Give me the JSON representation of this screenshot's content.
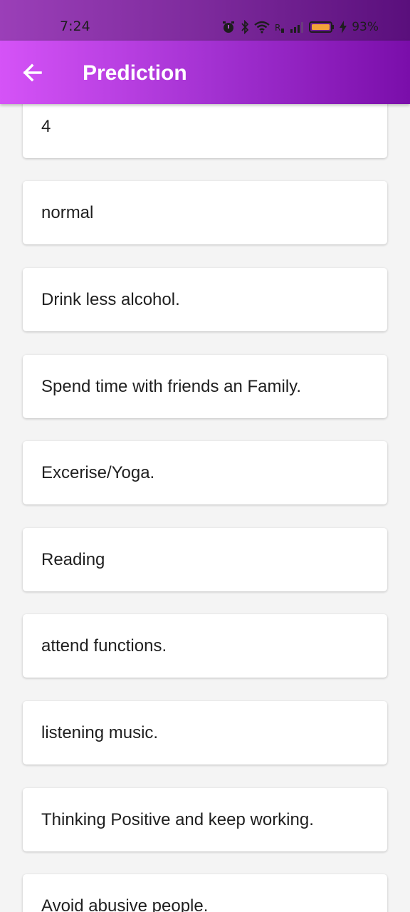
{
  "status_bar": {
    "time": "7:24",
    "battery_percent": "93%",
    "icons": [
      "alarm-icon",
      "bluetooth-icon",
      "wifi-icon",
      "network-icon",
      "signal-icon",
      "battery-icon",
      "charging-icon"
    ]
  },
  "app_bar": {
    "title": "Prediction",
    "back_icon": "arrow-left-icon"
  },
  "items": [
    "4",
    "normal",
    "Drink less alcohol.",
    "Spend time with friends an Family.",
    "Excerise/Yoga.",
    "Reading",
    "attend functions.",
    "listening music.",
    "Thinking Positive and keep working.",
    "Avoid abusive people."
  ],
  "colors": {
    "app_bar_start": "#d553f7",
    "app_bar_end": "#7a0eaa",
    "background": "#f4f4f4",
    "card": "#ffffff"
  }
}
